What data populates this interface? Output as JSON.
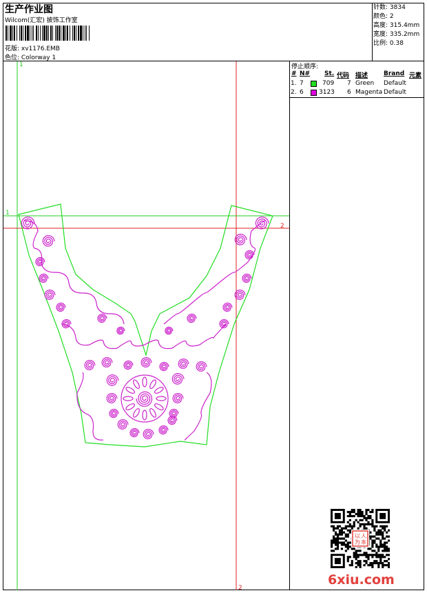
{
  "header": {
    "title": "生产作业图",
    "company": "Wilcom(汇宏) 披饰工作室",
    "design_label": "花版:",
    "design_value": "xv1176.EMB",
    "colorway_label": "色位:",
    "colorway_value": "Colorway 1"
  },
  "stats": [
    {
      "label": "针数:",
      "value": "3834"
    },
    {
      "label": "颜色:",
      "value": "2"
    },
    {
      "label": "高度:",
      "value": "315.4mm"
    },
    {
      "label": "宽度:",
      "value": "335.2mm"
    },
    {
      "label": "比例:",
      "value": "0.38"
    }
  ],
  "stop_sequence": {
    "title": "停止顺序:",
    "columns": [
      "#",
      "N#",
      "St.",
      "代码",
      "描述",
      "Brand",
      "元素"
    ],
    "rows": [
      {
        "index": "1.",
        "needle": "7",
        "color": "#22dd22",
        "code": "709",
        "stitches": "7",
        "desc": "Green",
        "brand": "Default"
      },
      {
        "index": "2.",
        "needle": "6",
        "color": "#dd00dd",
        "code": "3123",
        "stitches": "6",
        "desc": "Magenta",
        "brand": "Default"
      }
    ]
  },
  "guides": {
    "v1_label": "1",
    "v2_label": "2",
    "h1_label": "1",
    "h2_label": "2"
  },
  "colors": {
    "outline": "#22dd22",
    "embroidery": "#cc22cc",
    "guide_green": "#22cc22",
    "guide_red": "#dd2222",
    "logo": "#e2403c"
  },
  "watermark": {
    "logo_text": "6xiu.com",
    "stamp_text": "以人为本"
  }
}
